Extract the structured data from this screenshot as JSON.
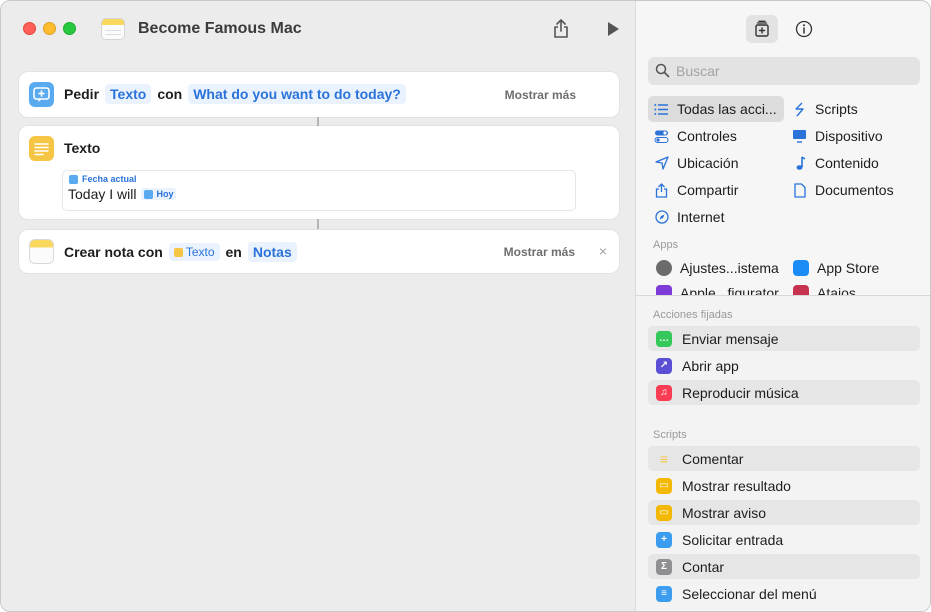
{
  "window": {
    "title": "Become Famous Mac"
  },
  "editor": {
    "ask_action": {
      "verb": "Pedir",
      "type_token": "Texto",
      "connector": "con",
      "prompt_token": "What do you want to do today?",
      "more_label": "Mostrar más"
    },
    "text_action": {
      "title": "Texto",
      "box_label": "Fecha actual",
      "body_text": "Today I will",
      "variable_token": "Hoy"
    },
    "note_action": {
      "verb": "Crear nota con",
      "text_token": "Texto",
      "connector": "en",
      "target_token": "Notas",
      "more_label": "Mostrar más",
      "close_glyph": "×"
    }
  },
  "sidebar": {
    "search_placeholder": "Buscar",
    "categories": [
      {
        "label": "Todas las acci...",
        "icon": "list-icon"
      },
      {
        "label": "Scripts",
        "icon": "scripts-icon"
      },
      {
        "label": "Controles",
        "icon": "toggles-icon"
      },
      {
        "label": "Dispositivo",
        "icon": "display-icon"
      },
      {
        "label": "Ubicación",
        "icon": "location-icon"
      },
      {
        "label": "Contenido",
        "icon": "music-note-icon"
      },
      {
        "label": "Compartir",
        "icon": "share-icon"
      },
      {
        "label": "Documentos",
        "icon": "document-icon"
      },
      {
        "label": "Internet",
        "icon": "compass-icon"
      }
    ],
    "apps_header": "Apps",
    "apps": [
      {
        "label": "Ajustes...istema",
        "color": "#6b6b6b"
      },
      {
        "label": "App Store",
        "color": "#1b8cf5"
      },
      {
        "label": "Apple...figurator",
        "color": "#7c3bd6"
      },
      {
        "label": "Atajos",
        "color": "#c7324f"
      }
    ],
    "pinned_header": "Acciones fijadas",
    "pinned": [
      {
        "label": "Enviar mensaje",
        "color": "#34c759",
        "glyph": "…"
      },
      {
        "label": "Abrir app",
        "color": "#5b4fd6",
        "glyph": "↗"
      },
      {
        "label": "Reproducir música",
        "color": "#fa3c55",
        "glyph": "♫"
      }
    ],
    "scripts_header": "Scripts",
    "scripts": [
      {
        "label": "Comentar",
        "color": "#f7c544",
        "glyph": "≡"
      },
      {
        "label": "Mostrar resultado",
        "color": "#f5b800",
        "glyph": "▭"
      },
      {
        "label": "Mostrar aviso",
        "color": "#f5b800",
        "glyph": "▭"
      },
      {
        "label": "Solicitar entrada",
        "color": "#3b9cf0",
        "glyph": "+"
      },
      {
        "label": "Contar",
        "color": "#8e8e93",
        "glyph": "Σ"
      },
      {
        "label": "Seleccionar del menú",
        "color": "#3b9cf0",
        "glyph": "≡"
      }
    ]
  }
}
